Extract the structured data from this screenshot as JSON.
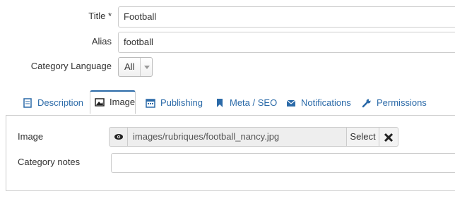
{
  "form": {
    "title_label": "Title *",
    "title_value": "Football",
    "alias_label": "Alias",
    "alias_value": "football",
    "language_label": "Category Language",
    "language_value": "All"
  },
  "tabs": [
    {
      "label": "Description",
      "icon": "document-icon"
    },
    {
      "label": "Image",
      "icon": "image-icon"
    },
    {
      "label": "Publishing",
      "icon": "calendar-icon"
    },
    {
      "label": "Meta / SEO",
      "icon": "bookmark-icon"
    },
    {
      "label": "Notifications",
      "icon": "envelope-icon"
    },
    {
      "label": "Permissions",
      "icon": "wrench-icon"
    }
  ],
  "image_tab": {
    "image_label": "Image",
    "image_path": "images/rubriques/football_nancy.jpg",
    "select_label": "Select",
    "notes_label": "Category notes",
    "notes_value": ""
  },
  "colors": {
    "link": "#2b6aa8",
    "border": "#cccccc",
    "addon_bg": "#eeeeee"
  }
}
